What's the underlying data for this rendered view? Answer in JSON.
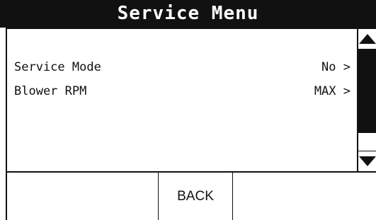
{
  "window": {
    "title": "Service Menu"
  },
  "menu": {
    "items": [
      {
        "label": "Service Mode",
        "value": "No >"
      },
      {
        "label": "Blower RPM",
        "value": "MAX >"
      }
    ]
  },
  "scrollbar": {
    "up_icon": "triangle-up-icon",
    "down_icon": "triangle-down-icon"
  },
  "buttons": {
    "left_label": "",
    "back_label": "BACK",
    "right_label": ""
  },
  "colors": {
    "foreground": "#111111",
    "background": "#ffffff"
  }
}
